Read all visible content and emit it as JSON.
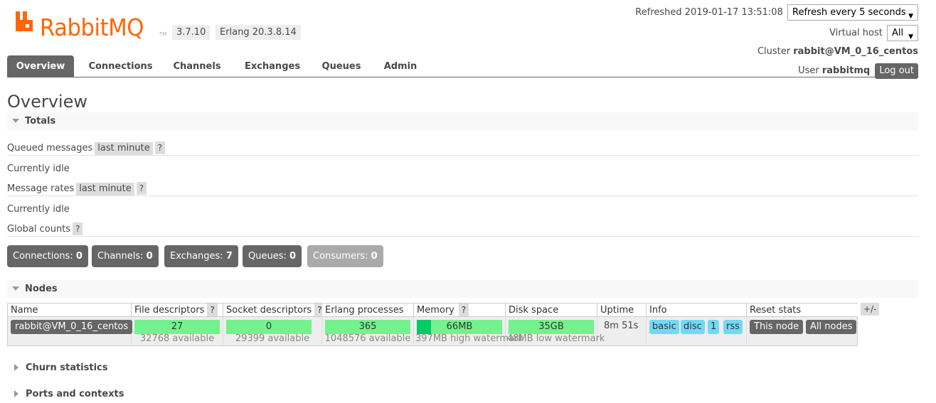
{
  "brand": {
    "name": "RabbitMQ",
    "tm": "TM",
    "color": "#ff6600"
  },
  "versions": {
    "rabbit": "3.7.10",
    "erlang": "Erlang 20.3.8.14"
  },
  "header": {
    "refreshed_label": "Refreshed",
    "refreshed_time": "2019-01-17 13:51:08",
    "refresh_select": "Refresh every 5 seconds",
    "vhost_label": "Virtual host",
    "vhost_select": "All",
    "cluster_label": "Cluster",
    "cluster_name": "rabbit@VM_0_16_centos",
    "user_label": "User",
    "user_name": "rabbitmq",
    "logout": "Log out"
  },
  "tabs": [
    {
      "label": "Overview",
      "active": true
    },
    {
      "label": "Connections"
    },
    {
      "label": "Channels"
    },
    {
      "label": "Exchanges"
    },
    {
      "label": "Queues"
    },
    {
      "label": "Admin"
    }
  ],
  "page_title": "Overview",
  "totals": {
    "heading": "Totals",
    "queued_label": "Queued messages",
    "queued_range": "last minute",
    "help": "?",
    "queued_status": "Currently idle",
    "rates_label": "Message rates",
    "rates_range": "last minute",
    "rates_status": "Currently idle",
    "global_label": "Global counts"
  },
  "counts": [
    {
      "label": "Connections:",
      "value": "0"
    },
    {
      "label": "Channels:",
      "value": "0"
    },
    {
      "label": "Exchanges:",
      "value": "7"
    },
    {
      "label": "Queues:",
      "value": "0"
    },
    {
      "label": "Consumers:",
      "value": "0"
    }
  ],
  "nodes": {
    "heading": "Nodes",
    "plusminus": "+/-",
    "columns": [
      "Name",
      "File descriptors",
      "Socket descriptors",
      "Erlang processes",
      "Memory",
      "Disk space",
      "Uptime",
      "Info",
      "Reset stats"
    ],
    "row": {
      "name": "rabbit@VM_0_16_centos",
      "fd": "27",
      "fd_avail": "32768 available",
      "sd": "0",
      "sd_avail": "29399 available",
      "ep": "365",
      "ep_avail": "1048576 available",
      "mem": "66MB",
      "mem_sub": "397MB high watermark",
      "disk": "35GB",
      "disk_sub": "48MB low watermark",
      "uptime": "8m 51s",
      "info": [
        "basic",
        "disc",
        "1",
        "rss"
      ],
      "reset_this": "This node",
      "reset_all": "All nodes"
    }
  },
  "collapsed": {
    "churn": "Churn statistics",
    "ports": "Ports and contexts"
  }
}
